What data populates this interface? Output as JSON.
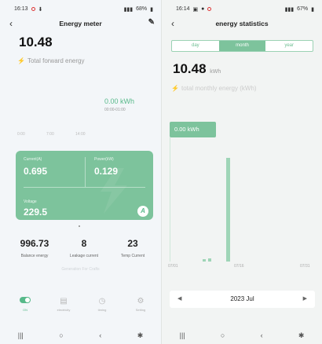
{
  "left": {
    "status": {
      "time": "16:13",
      "battery": "68%"
    },
    "header": {
      "title": "Energy meter",
      "back_icon": "chevron-left-icon",
      "edit_icon": "pencil-icon"
    },
    "total": {
      "value": "10.48",
      "label": "Total forward energy"
    },
    "summary": {
      "value": "0.00 kWh",
      "range": "00:00-01:00"
    },
    "axis": [
      "0:00",
      "7:00",
      "14:00"
    ],
    "card": {
      "current": {
        "label": "Current(A)",
        "value": "0.695"
      },
      "power": {
        "label": "Power(kW)",
        "value": "0.129"
      },
      "voltage": {
        "label": "Voltage",
        "value": "229.5"
      },
      "badge": "A"
    },
    "stats": [
      {
        "value": "996.73",
        "label": "Balance energy"
      },
      {
        "value": "8",
        "label": "Leakage current"
      },
      {
        "value": "23",
        "label": "Temp Current"
      }
    ],
    "generation_link": "Generation For Crafts",
    "nav": [
      {
        "label": "ON",
        "icon": "toggle-icon"
      },
      {
        "label": "electricity",
        "icon": "document-icon"
      },
      {
        "label": "timing",
        "icon": "clock-icon"
      },
      {
        "label": "Setting",
        "icon": "gear-icon"
      }
    ]
  },
  "right": {
    "status": {
      "time": "16:14",
      "battery": "67%"
    },
    "header": {
      "title": "energy statistics",
      "back_icon": "chevron-left-icon"
    },
    "tabs": [
      {
        "label": "day"
      },
      {
        "label": "month"
      },
      {
        "label": "year"
      }
    ],
    "active_tab": "month",
    "total": {
      "value": "10.48",
      "unit": "kWh",
      "label": "total monthly energy (kWh)"
    },
    "tooltip": "0.00 kWh",
    "x_ticks": [
      "07/01",
      "07/16",
      "07/31"
    ],
    "month_selector": {
      "label": "2023 Jul",
      "prev_icon": "triangle-left-icon",
      "next_icon": "triangle-right-icon"
    }
  },
  "chart_data": {
    "type": "bar",
    "x_ticks": [
      "07/01",
      "07/16",
      "07/31"
    ],
    "series": [
      {
        "values": [
          10.0,
          0.2,
          0.28
        ]
      }
    ],
    "tooltip": "0.00 kWh"
  },
  "system_nav": {
    "recents": "|||",
    "home": "○",
    "back": "‹",
    "accessibility": "accessibility-icon"
  },
  "colors": {
    "accent": "#57b98a",
    "card": "#7dc39c",
    "bolt": "#f2c10f"
  }
}
